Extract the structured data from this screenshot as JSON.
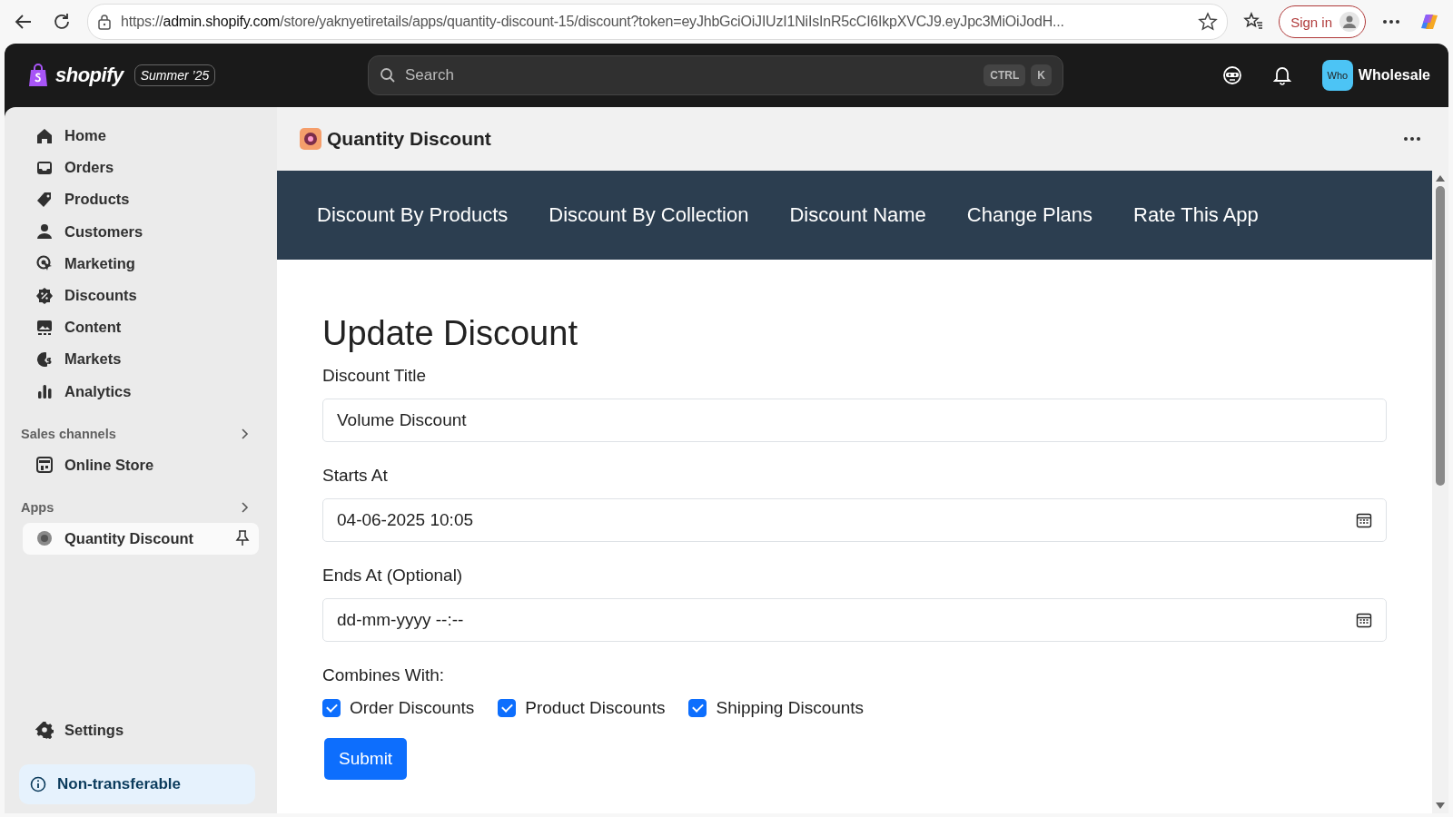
{
  "browser": {
    "url": {
      "scheme": "https://",
      "host": "admin.shopify.com",
      "rest": "/store/yaknyetiretails/apps/quantity-discount-15/discount?token=eyJhbGciOiJIUzI1NiIsInR5cCI6IkpXVCJ9.eyJpc3MiOiJodH..."
    },
    "sign_in": "Sign in"
  },
  "topbar": {
    "logo": "shopify",
    "edition": "Summer ’25",
    "search": {
      "placeholder": "Search",
      "keys": [
        "CTRL",
        "K"
      ]
    },
    "store": {
      "avatar": "Who",
      "name": "Wholesale"
    }
  },
  "sidebar": {
    "items": [
      {
        "label": "Home",
        "selected": false
      },
      {
        "label": "Orders",
        "selected": false
      },
      {
        "label": "Products",
        "selected": false
      },
      {
        "label": "Customers",
        "selected": false
      },
      {
        "label": "Marketing",
        "selected": false
      },
      {
        "label": "Discounts",
        "selected": false
      },
      {
        "label": "Content",
        "selected": false
      },
      {
        "label": "Markets",
        "selected": false
      },
      {
        "label": "Analytics",
        "selected": false
      }
    ],
    "sections": [
      {
        "title": "Sales channels",
        "items": [
          {
            "label": "Online Store",
            "selected": false,
            "pinned": false
          }
        ]
      },
      {
        "title": "Apps",
        "items": [
          {
            "label": "Quantity Discount",
            "selected": true,
            "pinned": true
          }
        ]
      }
    ],
    "settings": "Settings",
    "notice": "Non-transferable"
  },
  "app": {
    "title": "Quantity Discount",
    "nav": [
      "Discount By Products",
      "Discount By Collection",
      "Discount Name",
      "Change Plans",
      "Rate This App"
    ],
    "form": {
      "heading": "Update Discount",
      "fields": [
        {
          "label": "Discount Title",
          "value": "Volume Discount",
          "kind": "text"
        },
        {
          "label": "Starts At",
          "value": "04-06-2025 10:05",
          "kind": "datetime"
        },
        {
          "label": "Ends At (Optional)",
          "placeholder": "dd-mm-yyyy --:--",
          "kind": "datetime"
        }
      ],
      "combines_label": "Combines With:",
      "combines": [
        {
          "label": "Order Discounts",
          "checked": true
        },
        {
          "label": "Product Discounts",
          "checked": true
        },
        {
          "label": "Shipping Discounts",
          "checked": true
        }
      ],
      "submit": "Submit"
    }
  }
}
